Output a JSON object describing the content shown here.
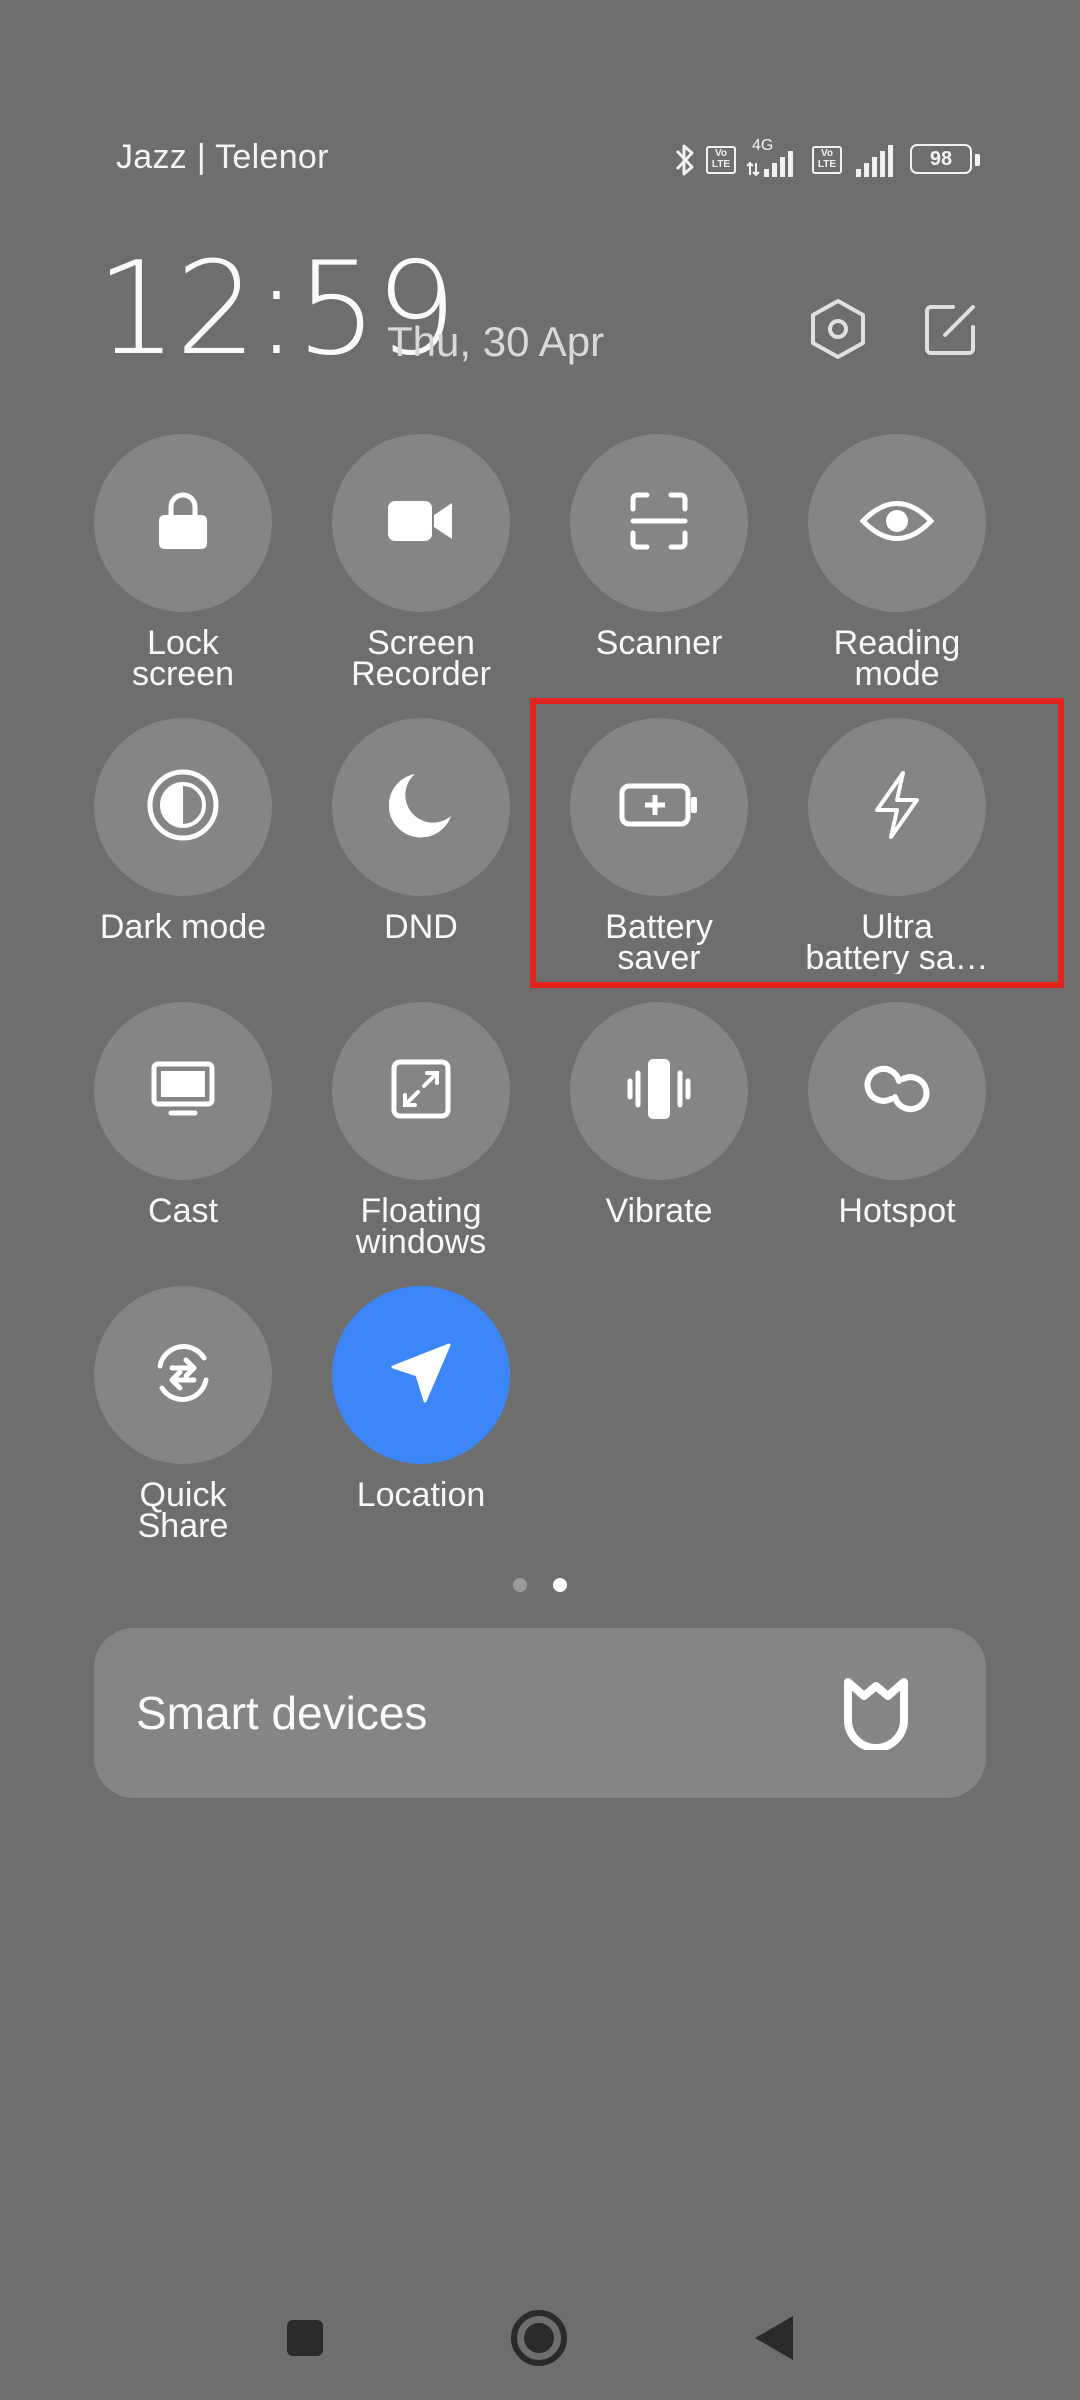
{
  "status_bar": {
    "carrier": "Jazz | Telenor",
    "network_type": "4G",
    "volte_label_top": "Vo",
    "volte_label_bottom": "LTE",
    "battery_level": "98"
  },
  "header": {
    "time": "12:59",
    "date": "Thu, 30 Apr",
    "settings_icon": "settings-hexagon-icon",
    "edit_icon": "edit-icon"
  },
  "tiles": [
    {
      "label": "Lock\nscreen",
      "icon": "lock-icon",
      "active": false
    },
    {
      "label": "Screen\nRecorder",
      "icon": "video-camera-icon",
      "active": false
    },
    {
      "label": "Scanner",
      "icon": "scan-frame-icon",
      "active": false
    },
    {
      "label": "Reading\nmode",
      "icon": "eye-icon",
      "active": false
    },
    {
      "label": "Dark mode",
      "icon": "contrast-icon",
      "active": false
    },
    {
      "label": "DND",
      "icon": "moon-icon",
      "active": false
    },
    {
      "label": "Battery\nsaver",
      "icon": "battery-plus-icon",
      "active": false
    },
    {
      "label": "Ultra\nbattery sa…",
      "icon": "lightning-icon",
      "active": false
    },
    {
      "label": "Cast",
      "icon": "monitor-icon",
      "active": false
    },
    {
      "label": "Floating\nwindows",
      "icon": "floating-window-icon",
      "active": false
    },
    {
      "label": "Vibrate",
      "icon": "vibrate-icon",
      "active": false
    },
    {
      "label": "Hotspot",
      "icon": "hotspot-link-icon",
      "active": false
    },
    {
      "label": "Quick\nShare",
      "icon": "quick-share-icon",
      "active": false
    },
    {
      "label": "Location",
      "icon": "location-arrow-icon",
      "active": true
    }
  ],
  "pager": {
    "pages": 2,
    "current_page": 2
  },
  "smart_devices": {
    "label": "Smart devices",
    "icon": "mi-home-icon"
  },
  "nav_bar": [
    "recents-square-icon",
    "home-circle-icon",
    "back-triangle-icon"
  ],
  "colors": {
    "background": "#6e6e6e",
    "tile_inactive": "#858585",
    "tile_active": "#3d86f8",
    "highlight_box": "#e3211f"
  }
}
